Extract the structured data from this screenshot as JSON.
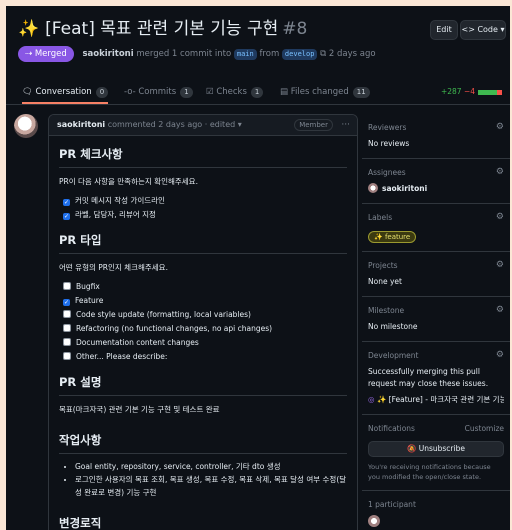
{
  "header": {
    "title": "[Feat] 목표 관련 기본 기능 구현",
    "number": "#8",
    "edit_label": "Edit",
    "code_label": "<> Code ▾"
  },
  "meta": {
    "badge": "Merged",
    "author": "saokiritoni",
    "text_a": "merged 1 commit into",
    "base": "main",
    "text_b": "from",
    "head": "develop",
    "time": "2 days ago"
  },
  "tabs": [
    {
      "label": "Conversation",
      "count": "0"
    },
    {
      "label": "Commits",
      "count": "1"
    },
    {
      "label": "Checks",
      "count": "1"
    },
    {
      "label": "Files changed",
      "count": "11"
    }
  ],
  "diff": {
    "add": "+287",
    "del": "−4"
  },
  "comment": {
    "author": "saokiritoni",
    "info": "commented 2 days ago · edited ▾",
    "role": "Member",
    "s1_title": "PR 체크사항",
    "s1_text": "PR이 다음 사항을 만족하는지 확인해주세요.",
    "s1_items": [
      "커밋 메시지 작성 가이드라인",
      "라벨, 담당자, 리뷰어 지정"
    ],
    "s2_title": "PR 타입",
    "s2_text": "어떤 유형의 PR인지 체크해주세요.",
    "s2_items": [
      "Bugfix",
      "Feature",
      "Code style update (formatting, local variables)",
      "Refactoring (no functional changes, no api changes)",
      "Documentation content changes",
      "Other... Please describe:"
    ],
    "s3_title": "PR 설명",
    "s3_text": "목표(마크자국) 관련 기본 기능 구현 및 테스트 완료",
    "s4_title": "작업사항",
    "s4_items": [
      "Goal entity, repository, service, controller, 기타 dto 생성",
      "로그인한 사용자의 목표 조회, 목표 생성, 목표 수정, 목표 삭제, 목표 달성 여부 수정(달성 완료로 변경) 기능 구현"
    ],
    "s5_title": "변경로직"
  },
  "sidebar": {
    "reviewers": {
      "title": "Reviewers",
      "value": "No reviews"
    },
    "assignees": {
      "title": "Assignees",
      "value": "saokiritoni"
    },
    "labels": {
      "title": "Labels",
      "value": "✨ feature"
    },
    "projects": {
      "title": "Projects",
      "value": "None yet"
    },
    "milestone": {
      "title": "Milestone",
      "value": "No milestone"
    },
    "development": {
      "title": "Development",
      "value": "Successfully merging this pull request may close these issues.",
      "issue": "✨ [Feature] - 마크자국 관련 기본 기능 개발 ..."
    },
    "notifications": {
      "title": "Notifications",
      "customize": "Customize",
      "button": "Unsubscribe",
      "note": "You're receiving notifications because you modified the open/close state."
    },
    "participants": {
      "title": "1 participant"
    }
  }
}
